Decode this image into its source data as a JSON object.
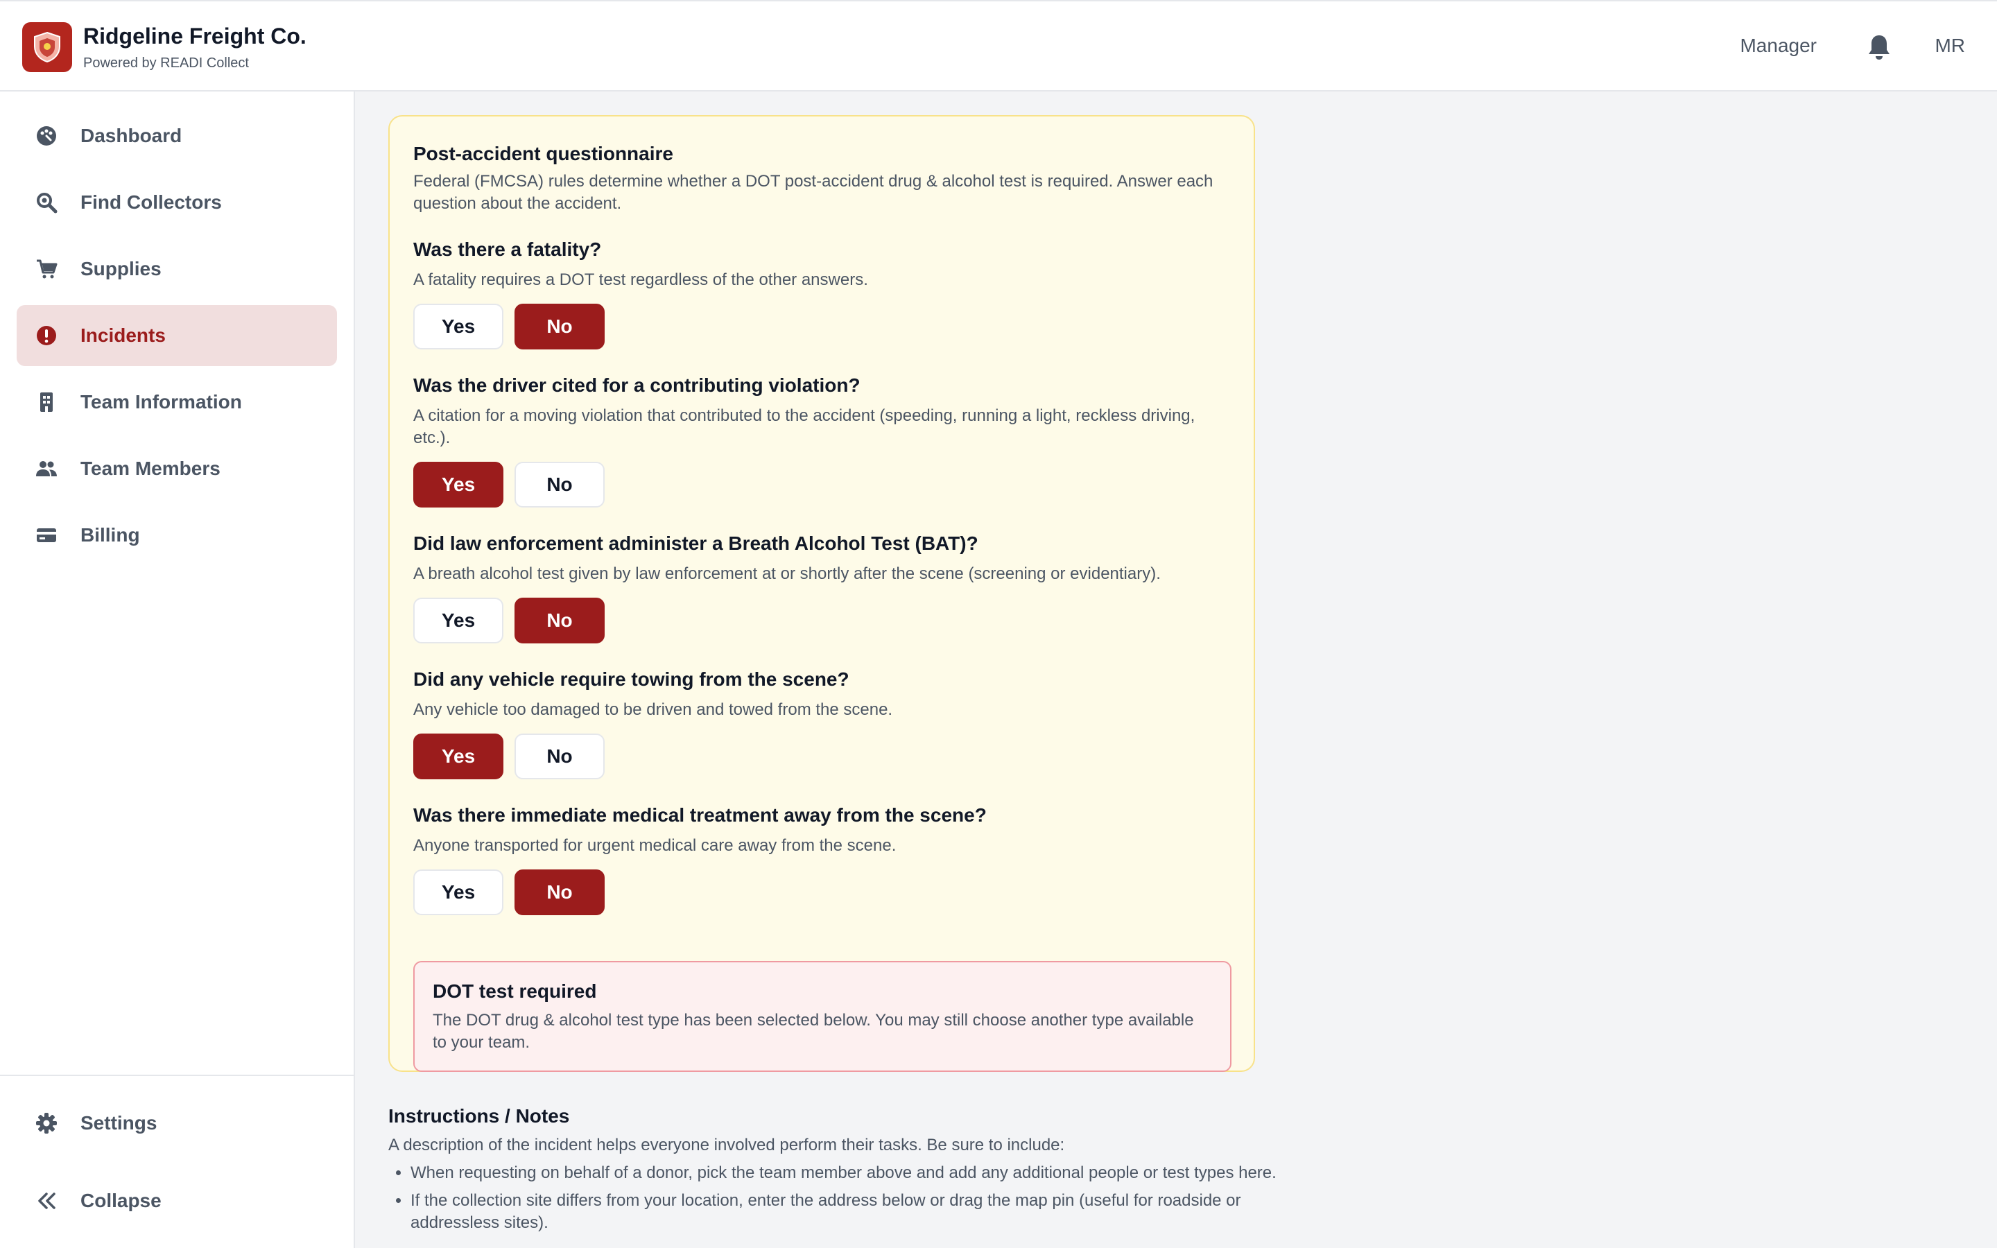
{
  "header": {
    "brand_title": "Ridgeline Freight Co.",
    "brand_sub": "Powered by READI Collect",
    "role": "Manager",
    "initials": "MR",
    "brand_color": "#b3261e"
  },
  "sidebar": {
    "items": [
      {
        "label": "Dashboard",
        "icon": "palette-icon"
      },
      {
        "label": "Find Collectors",
        "icon": "search-icon"
      },
      {
        "label": "Supplies",
        "icon": "cart-icon"
      },
      {
        "label": "Incidents",
        "icon": "alert-icon",
        "active": true
      },
      {
        "label": "Team Information",
        "icon": "building-icon"
      },
      {
        "label": "Team Members",
        "icon": "users-icon"
      },
      {
        "label": "Billing",
        "icon": "credit-card-icon"
      }
    ],
    "footer": [
      {
        "label": "Settings",
        "icon": "gear-icon"
      },
      {
        "label": "Collapse",
        "icon": "double-chevron-left-icon"
      }
    ]
  },
  "questionnaire": {
    "title": "Post-accident questionnaire",
    "description": "Federal (FMCSA) rules determine whether a DOT post-accident drug & alcohol test is required. Answer each question about the accident.",
    "yes_label": "Yes",
    "no_label": "No",
    "questions": [
      {
        "title": "Was there a fatality?",
        "help": "A fatality requires a DOT test regardless of the other answers.",
        "answer": "No"
      },
      {
        "title": "Was the driver cited for a contributing violation?",
        "help": "A citation for a moving violation that contributed to the accident (speeding, running a light, reckless driving, etc.).",
        "answer": "Yes"
      },
      {
        "title": "Did law enforcement administer a Breath Alcohol Test (BAT)?",
        "help": "A breath alcohol test given by law enforcement at or shortly after the scene (screening or evidentiary).",
        "answer": "No"
      },
      {
        "title": "Did any vehicle require towing from the scene?",
        "help": "Any vehicle too damaged to be driven and towed from the scene.",
        "answer": "Yes"
      },
      {
        "title": "Was there immediate medical treatment away from the scene?",
        "help": "Anyone transported for urgent medical care away from the scene.",
        "answer": "No"
      }
    ],
    "result": {
      "title": "DOT test required",
      "text": "The DOT drug & alcohol test type has been selected below. You may still choose another type available to your team."
    }
  },
  "notes": {
    "title": "Instructions / Notes",
    "description": "A description of the incident helps everyone involved perform their tasks. Be sure to include:",
    "bullets": [
      "When requesting on behalf of a donor, pick the team member above and add any additional people or test types here.",
      "If the collection site differs from your location, enter the address below or drag the map pin (useful for roadside or addressless sites)."
    ]
  }
}
